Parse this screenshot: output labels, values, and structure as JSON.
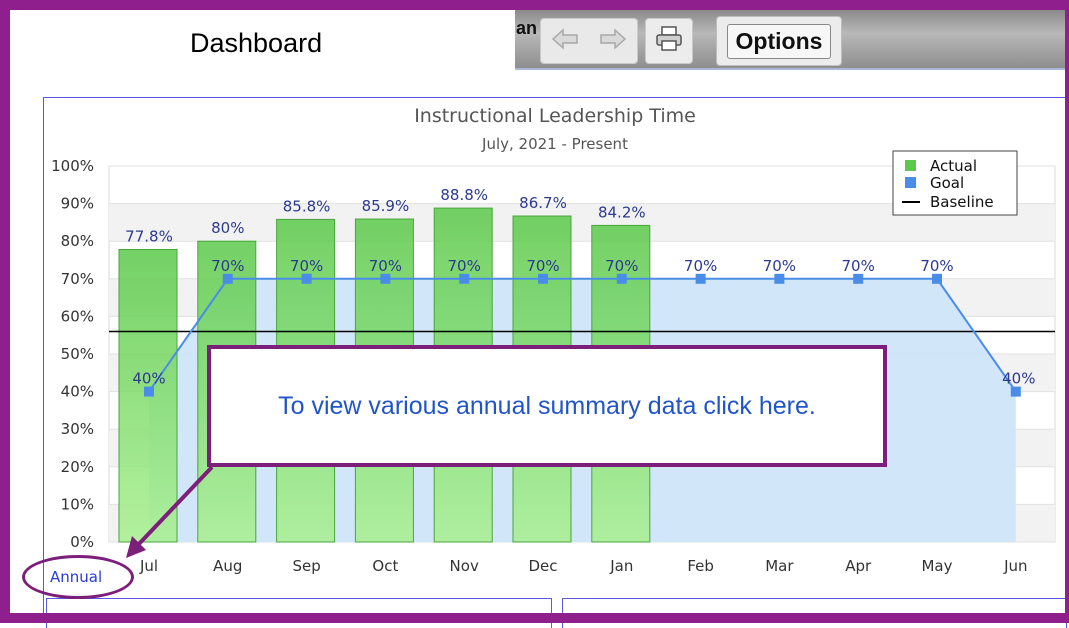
{
  "header": {
    "tab_title": "Dashboard",
    "hidden_tab_fragment": "an",
    "options_label": "Options",
    "icons": [
      "back-arrow-icon",
      "forward-arrow-icon",
      "printer-icon"
    ]
  },
  "callout": {
    "text": "To view various annual summary data click here."
  },
  "annual_link": "Annual",
  "colors": {
    "frame": "#8e1f8c",
    "actual_bar": "#5bc94a",
    "goal": "#4a8de8",
    "goal_area": "#cfe5f8",
    "baseline": "#000000",
    "label_text": "#2b3a8f",
    "panel_border": "#5a5ae0"
  },
  "chart_data": {
    "type": "bar",
    "title": "Instructional Leadership Time",
    "subtitle": "July, 2021 - Present",
    "categories": [
      "Jul",
      "Aug",
      "Sep",
      "Oct",
      "Nov",
      "Dec",
      "Jan",
      "Feb",
      "Mar",
      "Apr",
      "May",
      "Jun"
    ],
    "series": [
      {
        "name": "Actual",
        "kind": "bar",
        "values": [
          77.8,
          80,
          85.8,
          85.9,
          88.8,
          86.7,
          84.2,
          null,
          null,
          null,
          null,
          null
        ],
        "labels": [
          "77.8%",
          "80%",
          "85.8%",
          "85.9%",
          "88.8%",
          "86.7%",
          "84.2%",
          "",
          "",
          "",
          "",
          ""
        ]
      },
      {
        "name": "Goal",
        "kind": "line-area",
        "values": [
          40,
          70,
          70,
          70,
          70,
          70,
          70,
          70,
          70,
          70,
          70,
          40
        ],
        "labels": [
          "40%",
          "70%",
          "70%",
          "70%",
          "70%",
          "70%",
          "70%",
          "70%",
          "70%",
          "70%",
          "70%",
          "40%"
        ]
      },
      {
        "name": "Baseline",
        "kind": "hline",
        "value": 56
      }
    ],
    "yticks": [
      "0%",
      "10%",
      "20%",
      "30%",
      "40%",
      "50%",
      "60%",
      "70%",
      "80%",
      "90%",
      "100%"
    ],
    "ylim": [
      0,
      100
    ],
    "grid": true,
    "legend": "top-right"
  }
}
